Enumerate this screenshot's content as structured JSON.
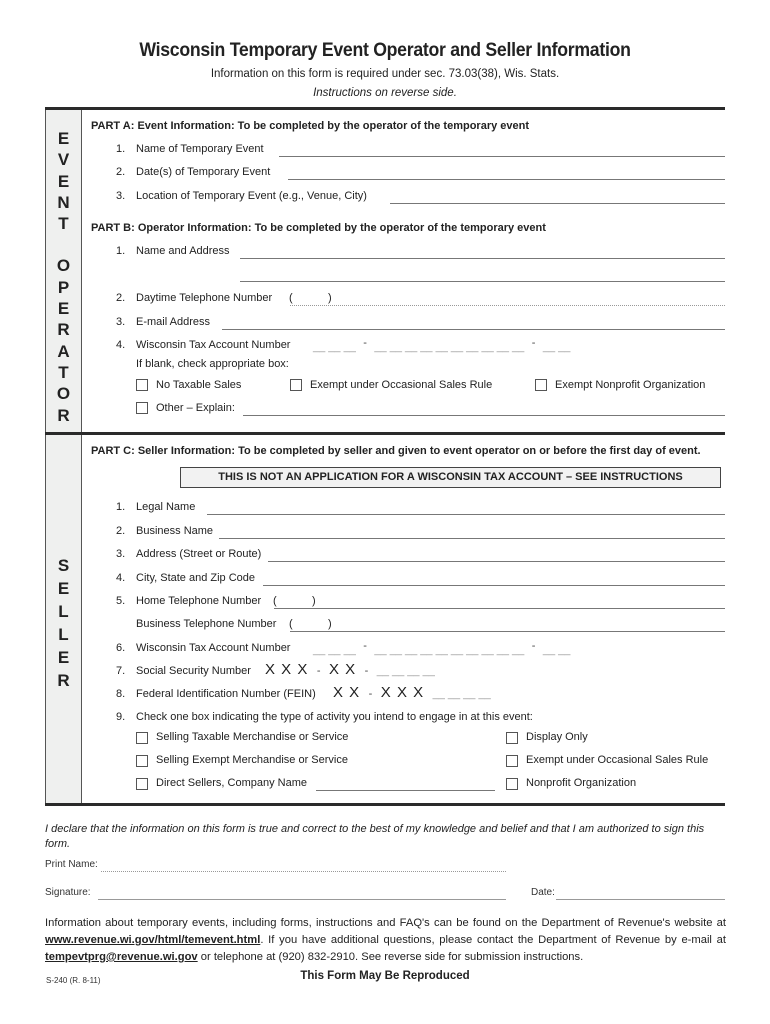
{
  "header": {
    "title": "Wisconsin Temporary Event Operator and Seller Information",
    "subtitle": "Information on this form is required under sec. 73.03(38), Wis. Stats.",
    "instructions_note": "Instructions on reverse side."
  },
  "sidebar": {
    "operator_letters": [
      "E",
      "V",
      "E",
      "N",
      "T",
      "",
      "O",
      "P",
      "E",
      "R",
      "A",
      "T",
      "O",
      "R"
    ],
    "seller_letters": [
      "S",
      "E",
      "L",
      "L",
      "E",
      "R"
    ]
  },
  "part_a": {
    "heading": "PART A:   Event Information:  To be completed by the operator of the temporary event",
    "items": [
      {
        "num": "1.",
        "label": "Name of Temporary Event",
        "value": ""
      },
      {
        "num": "2.",
        "label": "Date(s) of Temporary Event",
        "value": ""
      },
      {
        "num": "3.",
        "label": "Location of Temporary Event (e.g., Venue, City)",
        "value": ""
      }
    ]
  },
  "part_b": {
    "heading": "PART B:   Operator Information:  To be completed by the operator of the temporary event",
    "items": [
      {
        "num": "1.",
        "label": "Name and Address",
        "value": ""
      },
      {
        "num": "2.",
        "label": "Daytime Telephone Number",
        "phone_open": "(",
        "phone_close": ")",
        "value": ""
      },
      {
        "num": "3.",
        "label": "E-mail Address",
        "value": ""
      },
      {
        "num": "4.",
        "label": "Wisconsin Tax Account Number",
        "value": ""
      }
    ],
    "tax_account_mask": {
      "group1": "__ __ __",
      "sep": "-",
      "group2": "__ __ __ __ __ __ __ __ __ __",
      "group3": "__ __"
    },
    "if_blank_text": "If blank, check appropriate box:",
    "checkboxes": [
      {
        "label": "No Taxable Sales",
        "checked": false
      },
      {
        "label": "Exempt under Occasional Sales Rule",
        "checked": false
      },
      {
        "label": "Exempt Nonprofit Organization",
        "checked": false
      },
      {
        "label": "Other – Explain:",
        "checked": false
      }
    ]
  },
  "part_c": {
    "heading": "PART C:   Seller Information:  To be completed by seller and given to event operator on or before the first day of event.",
    "notice": "THIS IS NOT AN APPLICATION FOR A WISCONSIN TAX ACCOUNT – SEE INSTRUCTIONS",
    "items": [
      {
        "num": "1.",
        "label": "Legal Name",
        "value": ""
      },
      {
        "num": "2.",
        "label": "Business Name",
        "value": ""
      },
      {
        "num": "3.",
        "label": "Address (Street or Route)",
        "value": ""
      },
      {
        "num": "4.",
        "label": "City, State and Zip Code",
        "value": ""
      },
      {
        "num": "5.",
        "label": "Home Telephone Number",
        "value": ""
      },
      {
        "num": "",
        "label": "Business Telephone Number",
        "value": ""
      },
      {
        "num": "6.",
        "label": "Wisconsin Tax Account Number",
        "value": ""
      },
      {
        "num": "7.",
        "label": "Social Security Number",
        "value": ""
      },
      {
        "num": "8.",
        "label": "Federal Identification Number (FEIN)",
        "value": ""
      },
      {
        "num": "9.",
        "label": "Check one box indicating the type of activity you intend to engage in at this event:"
      }
    ],
    "phone_open": "(",
    "phone_close": ")",
    "ssn_mask": {
      "prefix1": "X X X",
      "sep": "-",
      "prefix2": "X X",
      "suffix": "__ __ __ __"
    },
    "fein_mask": {
      "prefix1": "X X",
      "sep": "-",
      "prefix2": "X X X",
      "suffix": "__ __ __ __"
    },
    "activity_checkboxes": [
      {
        "label": "Selling Taxable Merchandise or Service",
        "checked": false
      },
      {
        "label": "Display Only",
        "checked": false
      },
      {
        "label": "Selling Exempt Merchandise or Service",
        "checked": false
      },
      {
        "label": "Exempt under Occasional Sales Rule",
        "checked": false
      },
      {
        "label": "Direct Sellers, Company Name",
        "checked": false
      },
      {
        "label": "Nonprofit Organization",
        "checked": false
      }
    ]
  },
  "declaration": {
    "text": "I declare that the information on this form is true and correct to the best of my knowledge and belief and that I am authorized to sign this form.",
    "print_name_label": "Print Name:",
    "signature_label": "Signature:",
    "date_label": "Date:"
  },
  "footer": {
    "info_pre": "Information about temporary events, including forms, instructions and FAQ's can be found on the Department of Revenue's website at ",
    "website_link": "www.revenue.wi.gov/html/temevent.html",
    "info_mid": ".  If you have additional questions, please contact the Department of Revenue by e-mail at ",
    "email_link": "tempevtprg@revenue.wi.gov",
    "info_post": " or telephone at (920) 832-2910.  See reverse side for submission instructions.",
    "form_number": "S-240 (R. 8-11)",
    "reproduce_note": "This Form May Be Reproduced"
  }
}
